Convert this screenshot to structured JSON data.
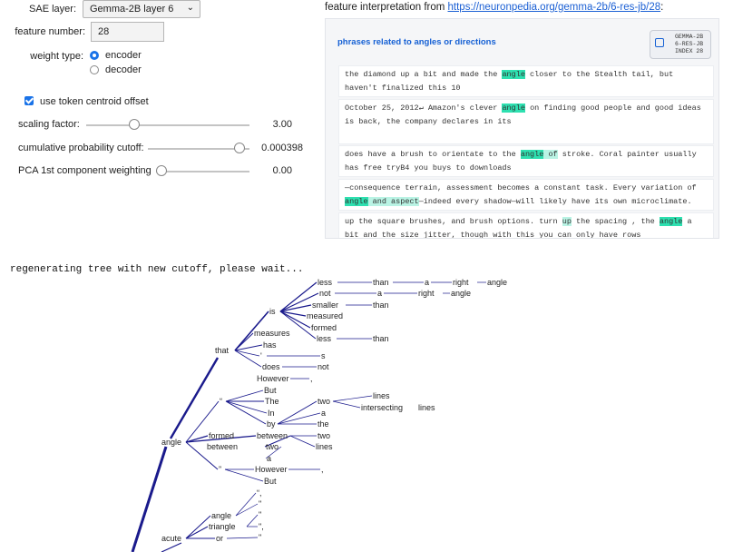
{
  "controls": {
    "sae_layer_label": "SAE layer:",
    "sae_layer_value": "Gemma-2B layer 6",
    "feature_number_label": "feature number:",
    "feature_number_value": "28",
    "weight_type_label": "weight type:",
    "weight_options": [
      "encoder",
      "decoder"
    ],
    "weight_selected": "encoder",
    "centroid_label": "use token centroid offset",
    "centroid_checked": true,
    "sliders": [
      {
        "label": "scaling factor:",
        "value": "3.00",
        "fraction": 0.28
      },
      {
        "label": "cumulative probability cutoff:",
        "value": "0.000398",
        "fraction": 0.95
      },
      {
        "label": "PCA 1st component weighting",
        "value": "0.00",
        "fraction": 0.0
      }
    ]
  },
  "neuronpedia": {
    "title_prefix": "feature interpretation from ",
    "link": "https://neuronpedia.org/gemma-2b/6-res-jb/28",
    "title_suffix": ":",
    "heading": "phrases related to angles or directions",
    "badge_lines": [
      "GEMMA-2B",
      "6-RES-JB",
      "INDEX 28"
    ],
    "snippets": [
      {
        "segments": [
          [
            "the diamond up a bit and made the ",
            ""
          ],
          [
            "angle",
            "hl"
          ],
          [
            " closer to the Stealth tail, but haven't finalized this 10",
            ""
          ]
        ]
      },
      {
        "segments": [
          [
            "October 25, 2012↵ Amazon's clever ",
            ""
          ],
          [
            "angle",
            "hl"
          ],
          [
            " on finding good people and good ideas is back, the company declares in its",
            ""
          ]
        ]
      },
      {
        "segments": [
          [
            "does have a brush to orientate to the ",
            ""
          ],
          [
            "angle",
            "hl"
          ],
          [
            " of",
            "hl2"
          ],
          [
            " stroke. Coral painter usually has free tryB4 you buys to downloads",
            ""
          ]
        ]
      },
      {
        "segments": [
          [
            "—consequence terrain, assessment becomes a constant task. Every variation of ",
            ""
          ],
          [
            "angle",
            "hl"
          ],
          [
            " and aspect",
            "hl2"
          ],
          [
            "—indeed every shadow—will likely have its own microclimate.",
            ""
          ]
        ]
      },
      {
        "segments": [
          [
            "up the square brushes, and brush options. turn ",
            ""
          ],
          [
            "up",
            "hl2"
          ],
          [
            " the spacing , the ",
            ""
          ],
          [
            "angle",
            "hl"
          ],
          [
            " a bit and the size jitter, though with this you can only have rows",
            ""
          ]
        ]
      }
    ]
  },
  "status": "regenerating tree with new cutoff, please wait...",
  "tree_labels": [
    "less",
    "than",
    "a",
    "right",
    "angle",
    "not",
    "a",
    "right",
    "angle",
    "smaller",
    "than",
    "measured",
    "formed",
    "less",
    "than",
    "is",
    "measures",
    "has",
    "'",
    "s",
    "does",
    "not",
    "that",
    "However",
    ",",
    "But",
    "The",
    "In",
    "by",
    "two",
    "lines",
    "intersecting",
    "lines",
    "a",
    "the",
    "“",
    "formed",
    "between",
    "two",
    "a",
    "between",
    "two",
    "lines",
    "angle",
    "”",
    "However",
    ",",
    "But",
    "“,",
    "\"",
    "\"",
    "\",",
    "\"",
    "angle",
    "triangle",
    "or",
    "acute"
  ]
}
